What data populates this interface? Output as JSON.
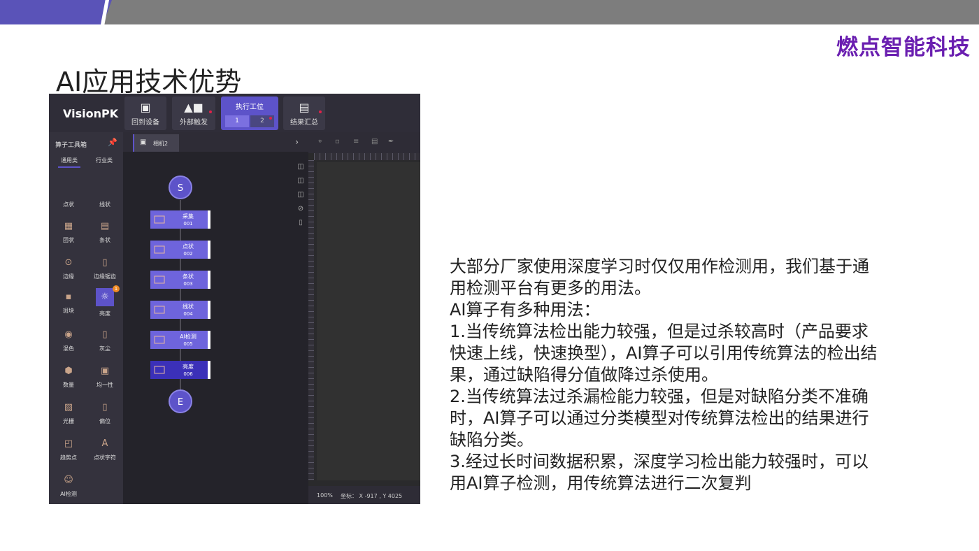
{
  "brand": "燃点智能科技",
  "title": "AI应用技术优势",
  "app": {
    "logo": "VisionPK",
    "header_buttons": [
      {
        "label": "回到设备",
        "icon": "monitor-icon"
      },
      {
        "label": "外部触发",
        "icon": "trigger-icon"
      },
      {
        "label": "结果汇总",
        "icon": "summary-icon"
      }
    ],
    "exec_station": {
      "title": "执行工位",
      "steps": [
        "1",
        "2"
      ]
    },
    "toolbox": {
      "title": "算子工具箱",
      "tabs": [
        "通用类",
        "行业类"
      ],
      "tools": [
        {
          "label": "点状",
          "icon": ""
        },
        {
          "label": "线状",
          "icon": ""
        },
        {
          "label": "团状",
          "icon": "blob-icon"
        },
        {
          "label": "条状",
          "icon": "stripe-icon"
        },
        {
          "label": "边缘",
          "icon": "edge-icon"
        },
        {
          "label": "边缘锯齿",
          "icon": "edge-sawtooth-icon"
        },
        {
          "label": "斑块",
          "icon": "patch-icon"
        },
        {
          "label": "亮度",
          "icon": "brightness-icon",
          "selected": true,
          "badge": "1"
        },
        {
          "label": "混色",
          "icon": "mixcolor-icon"
        },
        {
          "label": "灰尘",
          "icon": "dust-icon"
        },
        {
          "label": "数量",
          "icon": "count-icon"
        },
        {
          "label": "均一性",
          "icon": "uniformity-icon"
        },
        {
          "label": "光栅",
          "icon": "grating-icon"
        },
        {
          "label": "偏位",
          "icon": "offset-icon"
        },
        {
          "label": "趋势点",
          "icon": "trend-point-icon"
        },
        {
          "label": "点状字符",
          "icon": "dot-char-icon"
        },
        {
          "label": "AI检测",
          "icon": "ai-detect-icon"
        }
      ]
    },
    "camera_tab": "相机2",
    "flow": {
      "start": "S",
      "end": "E",
      "nodes": [
        {
          "label": "采集",
          "id": "001"
        },
        {
          "label": "点状",
          "id": "002"
        },
        {
          "label": "条状",
          "id": "003"
        },
        {
          "label": "线状",
          "id": "004"
        },
        {
          "label": "AI检测",
          "id": "005"
        },
        {
          "label": "亮度",
          "id": "006"
        }
      ]
    },
    "status": {
      "zoom": "100%",
      "coords": "坐标： X -917 , Y 4025"
    }
  },
  "description": [
    "大部分厂家使用深度学习时仅仅用作检测用，我们基于通用检测平台有更多的用法。",
    "AI算子有多种用法：",
    "1.当传统算法检出能力较强，但是过杀较高时（产品要求快速上线，快速换型），AI算子可以引用传统算法的检出结果，通过缺陷得分值做降过杀使用。",
    "2.当传统算法过杀漏检能力较强，但是对缺陷分类不准确时，AI算子可以通过分类模型对传统算法检出的结果进行缺陷分类。",
    "3.经过长时间数据积累，深度学习检出能力较强时，可以用AI算子检测，用传统算法进行二次复判"
  ],
  "colors": {
    "accent": "#5d53c9",
    "brand": "#6a1fb0",
    "topbar": "#7d7d7d"
  }
}
